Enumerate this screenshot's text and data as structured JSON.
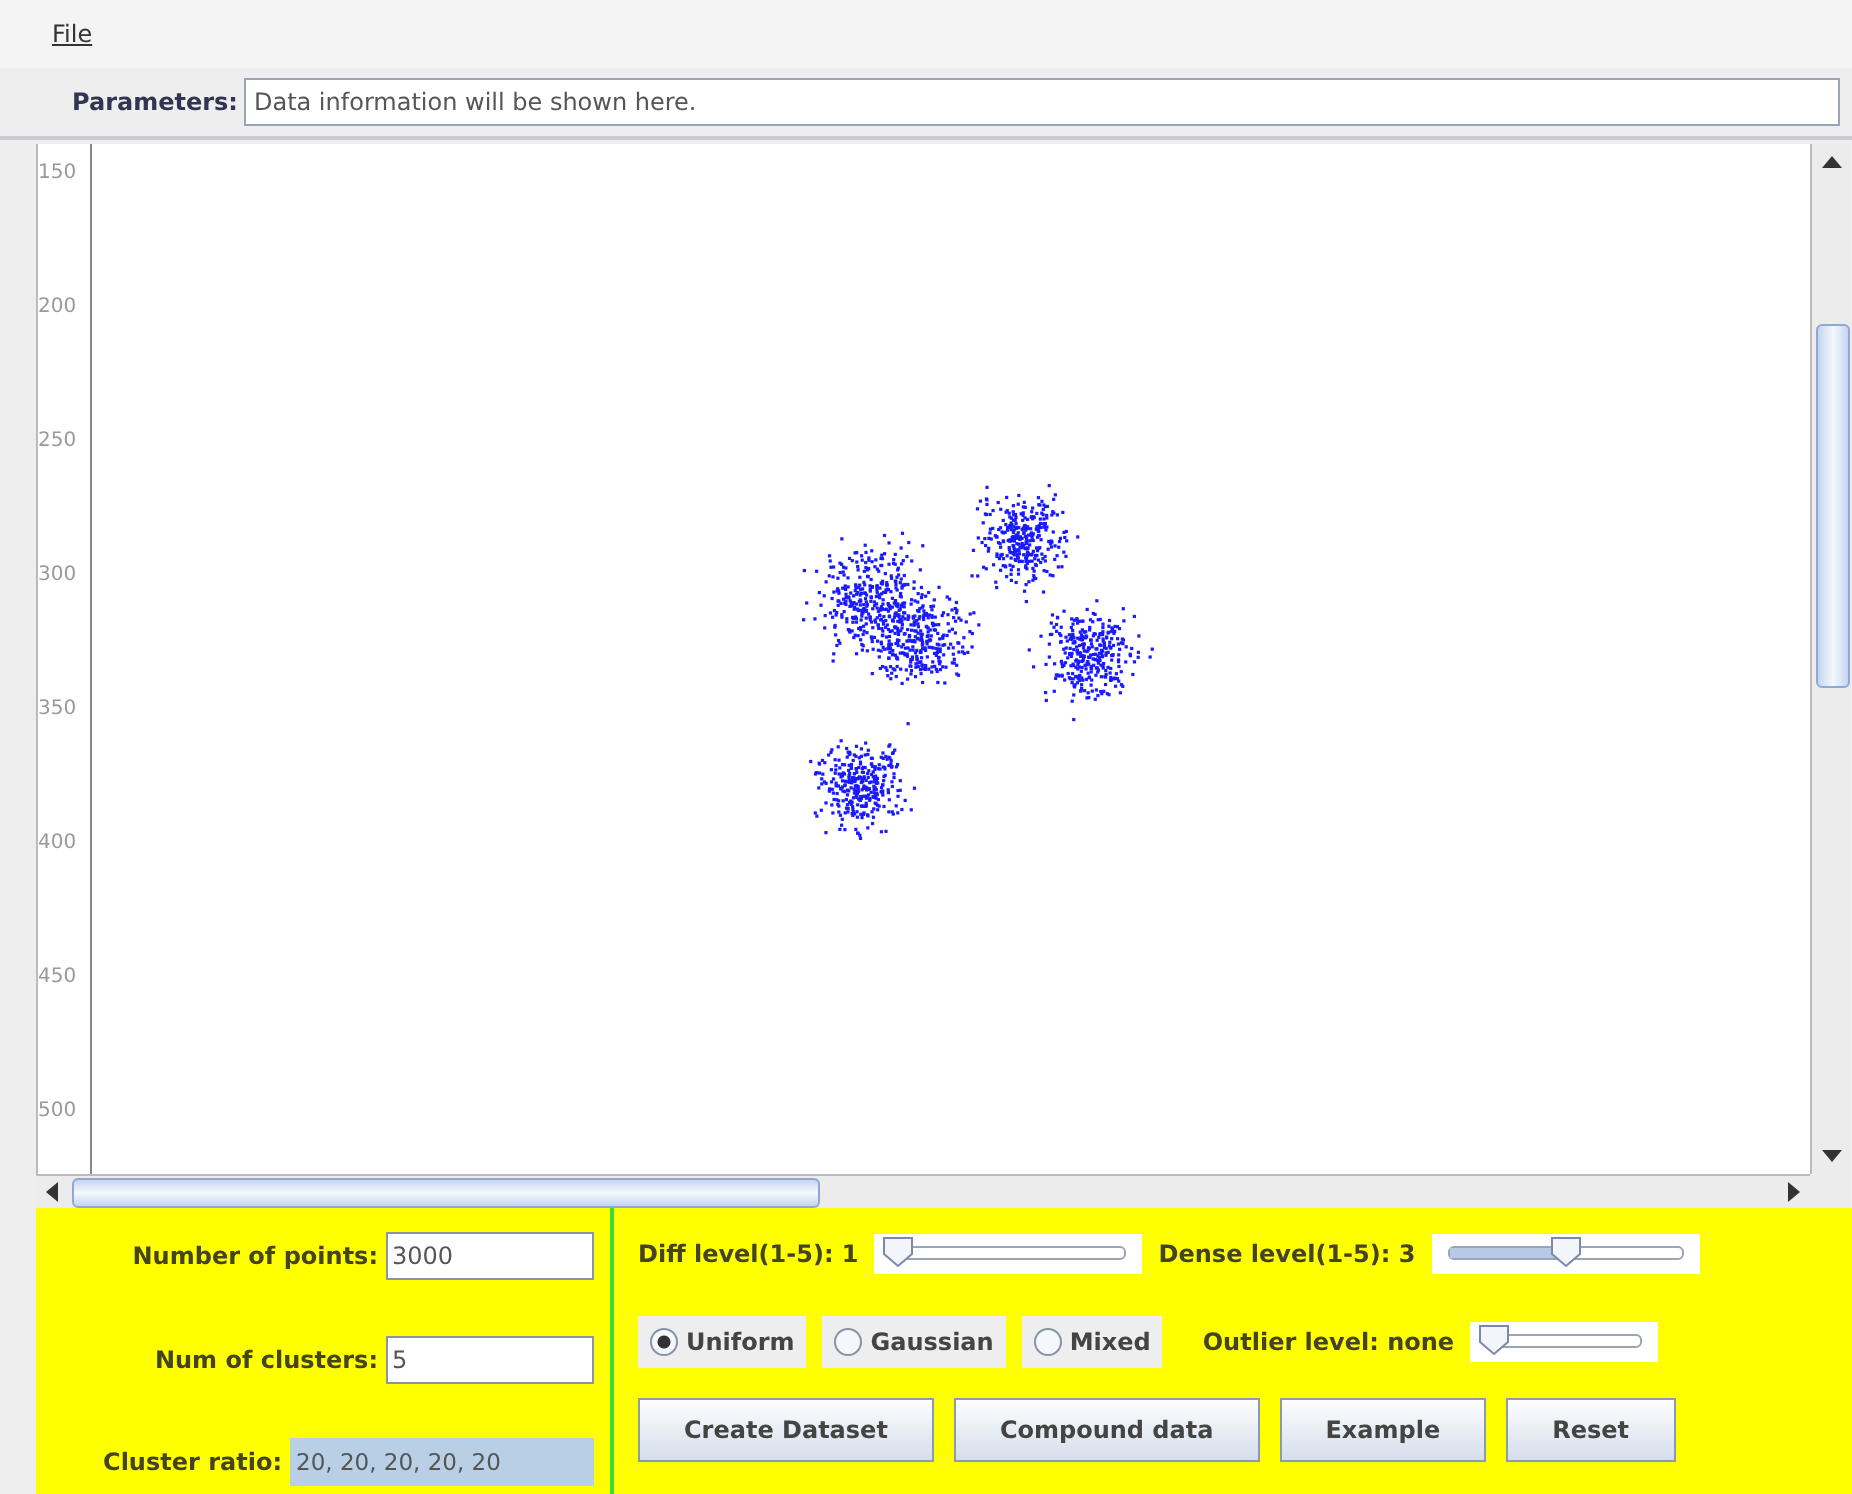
{
  "menu": [
    "File"
  ],
  "parameters": {
    "label": "Parameters:",
    "value": "Data information will be shown here."
  },
  "plot": {
    "yticks": [
      "150",
      "200",
      "250",
      "300",
      "350",
      "400",
      "450",
      "500"
    ]
  },
  "fields": [
    {
      "label": "Number of points:",
      "value": "3000",
      "selected_text": false
    },
    {
      "label": "Num of clusters:",
      "value": "5",
      "selected_text": false
    },
    {
      "label": "Cluster ratio:",
      "value": "20, 20, 20, 20, 20",
      "selected_text": true
    }
  ],
  "sliders": [
    {
      "label": "Diff level(1-5): 1",
      "level": 0
    },
    {
      "label": "Dense level(1-5): 3",
      "level": 0.5
    },
    {
      "label": "Outlier level:  none",
      "level": 0
    }
  ],
  "distribution": [
    {
      "label": "Uniform",
      "selected": true
    },
    {
      "label": "Gaussian",
      "selected": false
    },
    {
      "label": "Mixed",
      "selected": false
    }
  ],
  "buttons": [
    "Create Dataset",
    "Compound data",
    "Example",
    "Reset"
  ]
}
